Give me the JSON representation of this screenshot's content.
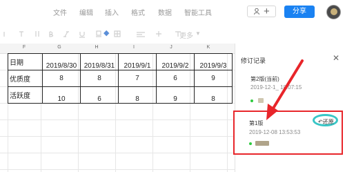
{
  "menubar": {
    "items": [
      "文件",
      "编辑",
      "插入",
      "格式",
      "数据",
      "智能工具"
    ],
    "share_label": "分享",
    "share_user_plus": "+"
  },
  "toolbar": {
    "more_label": "更多"
  },
  "sheet": {
    "column_headers": [
      "F",
      "G",
      "H",
      "I",
      "J",
      "K"
    ],
    "rows": [
      {
        "label": "日期",
        "values": [
          "2019/8/30",
          "2019/8/31",
          "2019/9/1",
          "2019/9/2",
          "2019/9/3"
        ]
      },
      {
        "label": "优质度",
        "values": [
          "8",
          "8",
          "7",
          "6",
          "9"
        ]
      },
      {
        "label": "活跃度",
        "values": [
          "10",
          "6",
          "8",
          "9",
          "8"
        ]
      }
    ]
  },
  "panel": {
    "title": "修订记录",
    "close_glyph": "✕",
    "versions": [
      {
        "title": "第2版(当前)",
        "time": "2019-12-1_ 18:07:15"
      },
      {
        "title": "第1版",
        "time": "2019-12-08 13:53:53",
        "restore_label": "还原"
      }
    ]
  },
  "annotation": {
    "arrow_color": "#e8252a",
    "highlight_color": "#38c6c6"
  },
  "colors": {
    "accent": "#1a82f2",
    "status_dot": "#2ecb3f"
  }
}
